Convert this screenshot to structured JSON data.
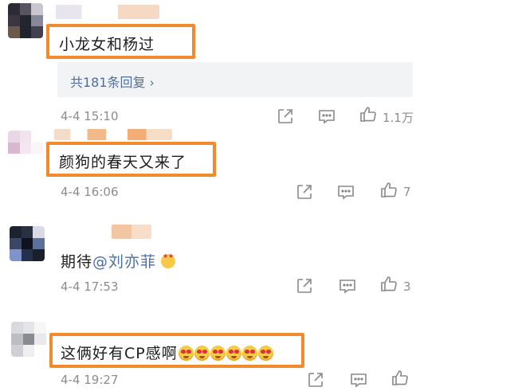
{
  "comments": [
    {
      "text": "小龙女和杨过",
      "replies_label": "共181条回复",
      "time": "4-4 15:10",
      "likes": "1.1万"
    },
    {
      "text": "颜狗的春天又来了",
      "time": "4-4 16:06",
      "likes": "7"
    },
    {
      "text_prefix": "期待",
      "mention": "@刘亦菲",
      "emoji": "star-struck-emoji",
      "time": "4-4 17:53",
      "likes": "3"
    },
    {
      "text": "这俩好有CP感啊",
      "emoji_count": 6,
      "emoji": "heart-eyes-emoji",
      "time": "4-4 19:27",
      "likes": ""
    }
  ],
  "icons": {
    "share": "share-icon",
    "comment": "comment-icon",
    "like": "thumbs-up-icon",
    "chevron": "chevron-right-icon"
  },
  "colors": {
    "highlight": "#f28a2e",
    "link": "#4f6f9e",
    "meta": "#8d8d8d"
  }
}
